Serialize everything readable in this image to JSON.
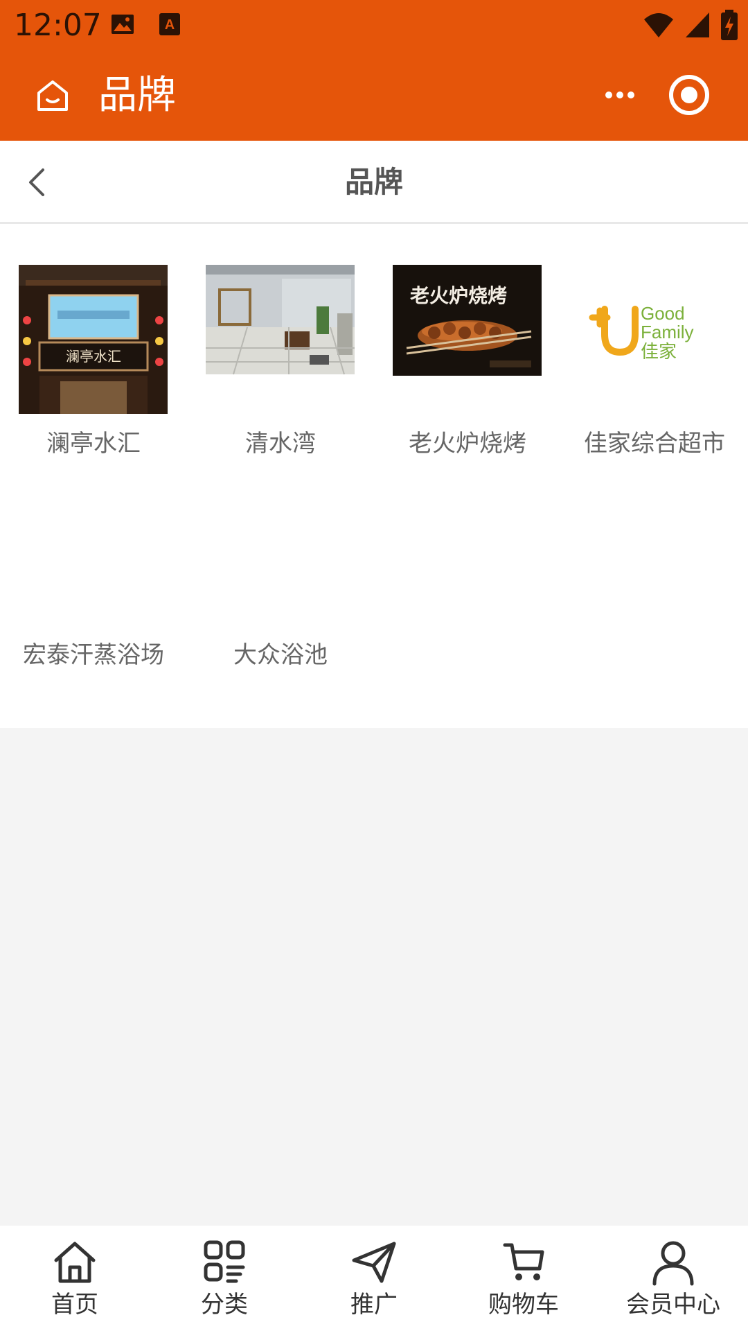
{
  "status_bar": {
    "time": "12:07"
  },
  "title_bar": {
    "title": "品牌",
    "home_icon": "home-icon",
    "more_icon": "more-icon",
    "target_icon": "record-icon",
    "background": "#E5550A"
  },
  "sub_nav": {
    "title": "品牌",
    "back_icon": "chevron-left-icon"
  },
  "brands": [
    {
      "name": "澜亭水汇",
      "image_text": "澜亭水汇"
    },
    {
      "name": "清水湾"
    },
    {
      "name": "老火炉烧烤",
      "image_text": "老火炉烧烤"
    },
    {
      "name": "佳家综合超市",
      "logo_text_1": "Good",
      "logo_text_2": "Family",
      "logo_text_3": "佳家"
    },
    {
      "name": "宏泰汗蒸浴场"
    },
    {
      "name": "大众浴池"
    }
  ],
  "tabbar": {
    "items": [
      {
        "label": "首页",
        "icon": "home-icon"
      },
      {
        "label": "分类",
        "icon": "category-icon"
      },
      {
        "label": "推广",
        "icon": "paper-plane-icon"
      },
      {
        "label": "购物车",
        "icon": "cart-icon"
      },
      {
        "label": "会员中心",
        "icon": "user-icon"
      }
    ]
  }
}
